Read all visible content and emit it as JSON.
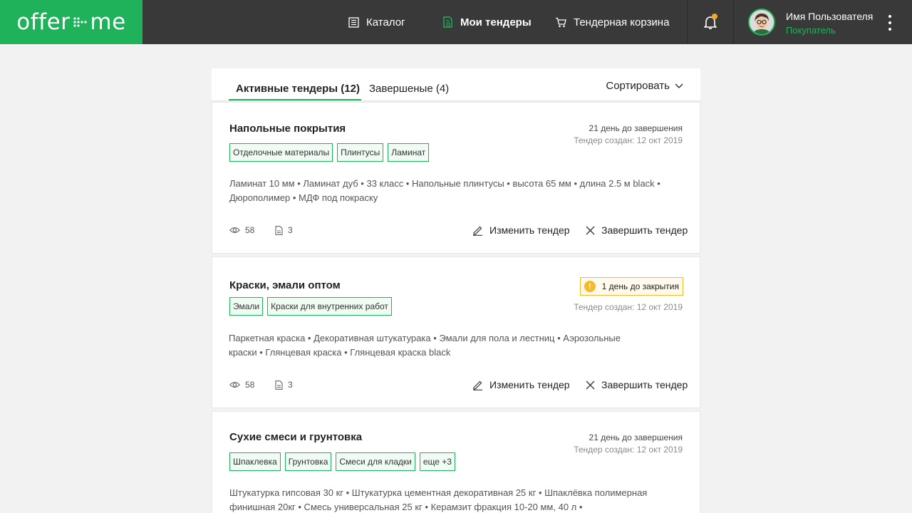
{
  "brand": {
    "logo_left": "offer",
    "logo_right": "me",
    "accent": "#1fb25a",
    "warning": "#f5b82e"
  },
  "nav": {
    "catalog": "Каталог",
    "my_tenders": "Мои тендеры",
    "cart": "Тендерная корзина"
  },
  "user": {
    "name": "Имя Пользователя",
    "role": "Покупатель"
  },
  "tabs": {
    "active": "Активные тендеры (12)",
    "completed": "Завершеные (4)",
    "sort": "Сортировать"
  },
  "tenders": [
    {
      "title": "Напольные покрытия",
      "deadline": "21 день до завершения",
      "created": "Тендер создан: 12 окт 2019",
      "tags": [
        "Отделочные материалы",
        "Плинтусы",
        "Ламинат"
      ],
      "description": "Ламинат 10 мм  • Ламинат дуб • 33 класс • Напольные плинтусы • высота 65 мм • длина 2.5 м black • Дюрополимер • МДФ под покраску",
      "views": "58",
      "docs": "3",
      "edit_label": "Изменить тендер",
      "finish_label": "Завершить тендер"
    },
    {
      "title": "Краски, эмали оптом",
      "warning": "1 день до закрытия",
      "created": "Тендер создан: 12 окт 2019",
      "tags": [
        "Эмали",
        "Краски для внутренних работ"
      ],
      "description": "Паркетная краска • Декоративная штукатурака • Эмали для пола и лестниц • Аэрозольные краски • Глянцевая краска • Глянцевая краска black",
      "views": "58",
      "docs": "3",
      "edit_label": "Изменить тендер",
      "finish_label": "Завершить тендер"
    },
    {
      "title": "Сухие смеси и грунтовка",
      "deadline": "21 день до завершения",
      "created": "Тендер создан: 12 окт 2019",
      "tags": [
        "Шпаклевка",
        "Грунтовка",
        "Смеси для кладки",
        "еще +3"
      ],
      "description": "Штукатурка гипсовая 30 кг • Штукатурка цементная декоративная  25 кг • Шпаклёвка полимерная финишная 20кг • Смесь универсальная 25 кг • Керамзит фракция 10-20 мм, 40 л •"
    }
  ]
}
